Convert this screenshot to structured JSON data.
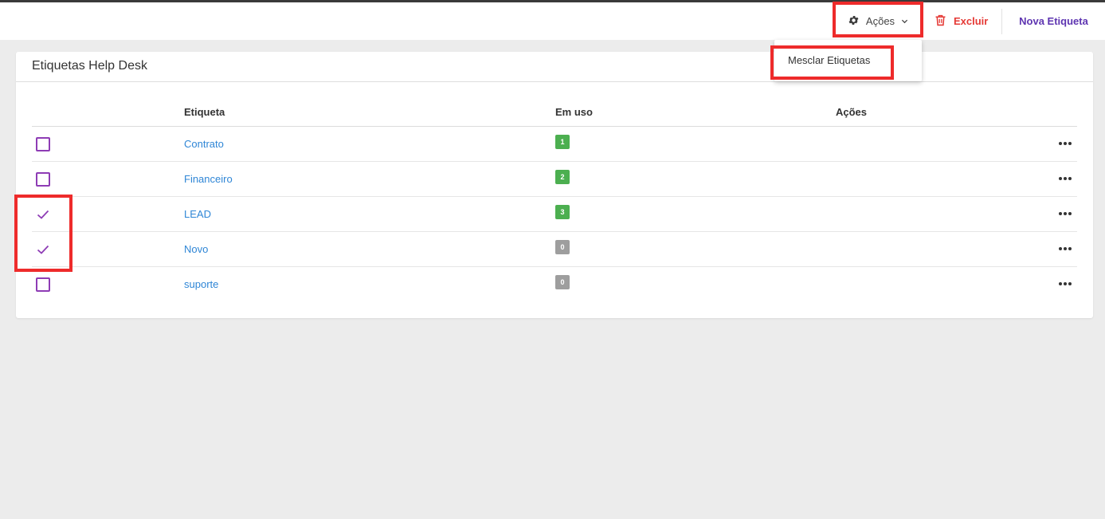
{
  "colors": {
    "accent_purple": "#5e35b1",
    "checkbox_purple": "#8e3cb5",
    "delete_red": "#e53935",
    "link_blue": "#2f86d6",
    "badge_green": "#4caf50",
    "badge_gray": "#9e9e9e",
    "highlight_red": "#ee2b2b"
  },
  "toolbar": {
    "actions_label": "Ações",
    "actions_icon": "gear-icon",
    "actions_chevron": "chevron-down-icon",
    "delete_label": "Excluir",
    "delete_icon": "trash-icon",
    "new_label": "Nova Etiqueta"
  },
  "actions_menu": {
    "items": [
      {
        "label": "Mesclar Etiquetas"
      }
    ]
  },
  "card": {
    "title": "Etiquetas Help Desk"
  },
  "table": {
    "headers": {
      "tag": "Etiqueta",
      "in_use": "Em uso",
      "actions": "Ações"
    },
    "rows": [
      {
        "tag": "Contrato",
        "in_use": "1",
        "checked": false,
        "badge_color": "#4caf50"
      },
      {
        "tag": "Financeiro",
        "in_use": "2",
        "checked": false,
        "badge_color": "#4caf50"
      },
      {
        "tag": "LEAD",
        "in_use": "3",
        "checked": true,
        "badge_color": "#4caf50"
      },
      {
        "tag": "Novo",
        "in_use": "0",
        "checked": true,
        "badge_color": "#9e9e9e"
      },
      {
        "tag": "suporte",
        "in_use": "0",
        "checked": false,
        "badge_color": "#9e9e9e"
      }
    ]
  }
}
